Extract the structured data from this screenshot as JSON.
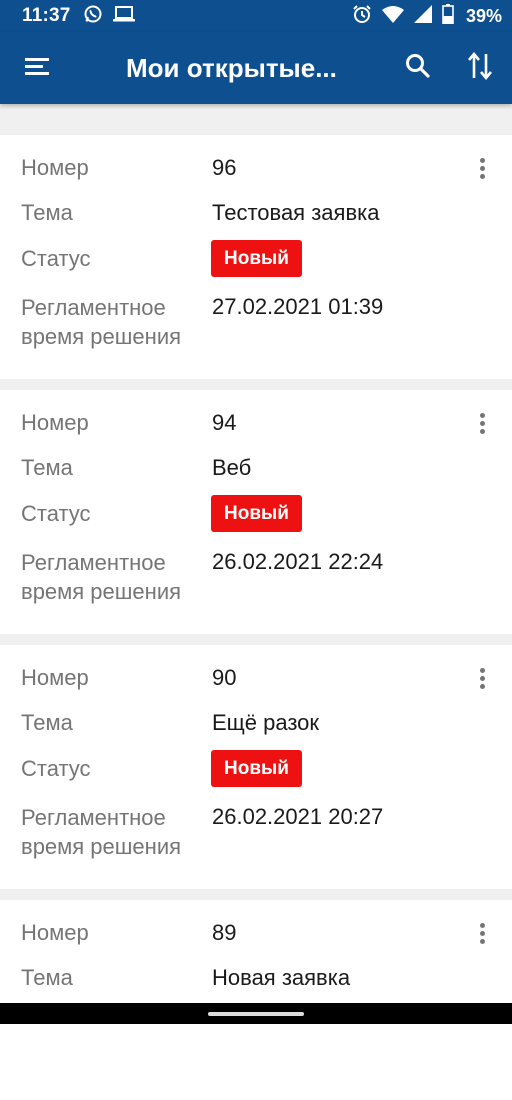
{
  "status_bar": {
    "time": "11:37",
    "battery": "39%",
    "icons_left": [
      "whatsapp-icon",
      "laptop-icon"
    ],
    "icons_right": [
      "alarm-icon",
      "wifi-icon",
      "signal-icon",
      "battery-icon"
    ]
  },
  "app_bar": {
    "title": "Мои открытые...",
    "menu_icon": "hamburger-menu-icon",
    "search_icon": "search-icon",
    "sort_icon": "sort-icon"
  },
  "colors": {
    "primary": "#0d4f8f",
    "badge_red": "#ee1111",
    "label_gray": "#757575",
    "background": "#f0f0f0"
  },
  "fields": {
    "number": "Номер",
    "theme": "Тема",
    "status": "Статус",
    "deadline_line1": "Регламентное",
    "deadline_line2": "время решения"
  },
  "tickets": [
    {
      "number": "96",
      "theme": "Тестовая заявка",
      "status": "Новый",
      "deadline": "27.02.2021 01:39"
    },
    {
      "number": "94",
      "theme": "Веб",
      "status": "Новый",
      "deadline": "26.02.2021 22:24"
    },
    {
      "number": "90",
      "theme": "Ещё разок",
      "status": "Новый",
      "deadline": "26.02.2021 20:27"
    },
    {
      "number": "89",
      "theme": "Новая заявка"
    }
  ]
}
